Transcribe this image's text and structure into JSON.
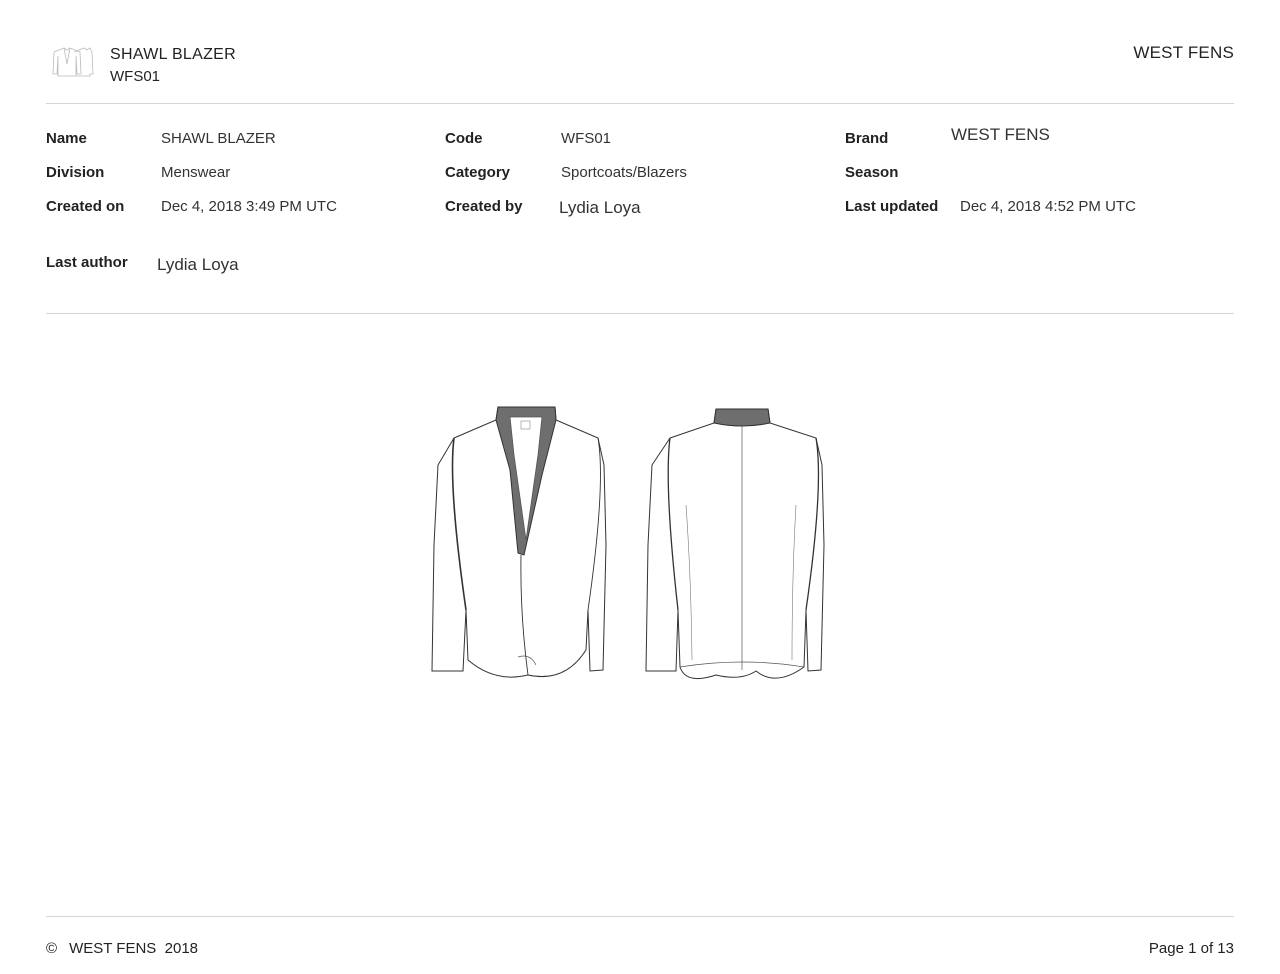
{
  "header": {
    "title": "SHAWL BLAZER",
    "code": "WFS01",
    "brand": "WEST FENS",
    "thumbnail_icon": "blazer-thumbnail-icon"
  },
  "details": {
    "name_label": "Name",
    "name_value": "SHAWL BLAZER",
    "code_label": "Code",
    "code_value": "WFS01",
    "brand_label": "Brand",
    "brand_value": "WEST FENS",
    "division_label": "Division",
    "division_value": "Menswear",
    "category_label": "Category",
    "category_value": "Sportcoats/Blazers",
    "season_label": "Season",
    "season_value": "",
    "created_on_label": "Created on",
    "created_on_value": "Dec 4, 2018 3:49 PM UTC",
    "created_by_label": "Created by",
    "created_by_value": "Lydia Loya",
    "last_updated_label": "Last updated",
    "last_updated_value": "Dec 4, 2018 4:52 PM UTC",
    "last_author_label": "Last author",
    "last_author_value": "Lydia Loya"
  },
  "sketch": {
    "front_icon": "blazer-front-sketch",
    "back_icon": "blazer-back-sketch",
    "collar_color": "#6e6e6e"
  },
  "footer": {
    "copyright_symbol": "©",
    "copyright_text": "WEST FENS  2018",
    "page_label": "Page 1 of 13"
  }
}
